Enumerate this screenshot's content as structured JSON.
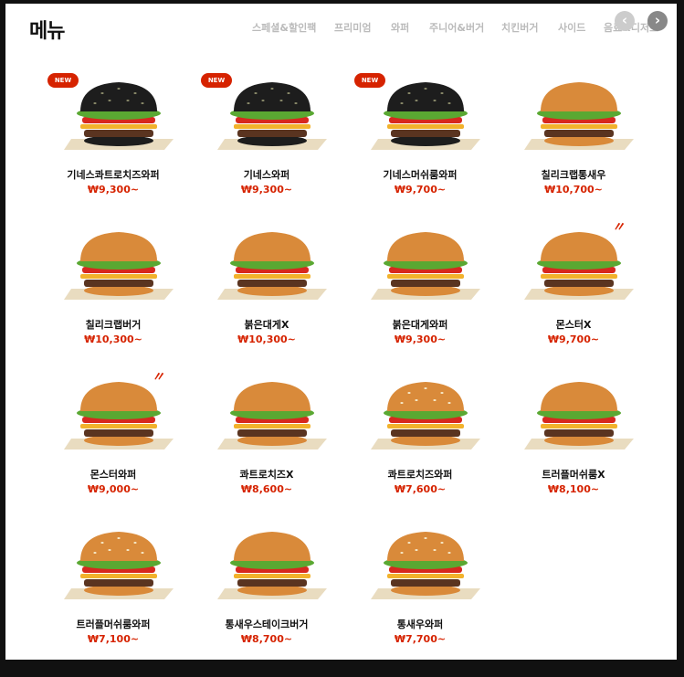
{
  "logo": "메뉴",
  "nav": {
    "items": [
      {
        "label": "스페셜&할인팩",
        "active": false
      },
      {
        "label": "프리미엄",
        "active": true
      },
      {
        "label": "와퍼",
        "active": false
      },
      {
        "label": "주니어&버거",
        "active": false
      },
      {
        "label": "치킨버거",
        "active": false
      },
      {
        "label": "사이드",
        "active": false
      },
      {
        "label": "음료&디저트",
        "active": false
      }
    ],
    "prev_icon": "chevron-left-icon",
    "next_icon": "chevron-right-icon",
    "prev_glyph": "‹",
    "next_glyph": "›"
  },
  "products": [
    {
      "name": "기네스콰트로치즈와퍼",
      "price": "₩9,300~",
      "badge": "NEW",
      "bun": "black"
    },
    {
      "name": "기네스와퍼",
      "price": "₩9,300~",
      "badge": "NEW",
      "bun": "black"
    },
    {
      "name": "기네스머쉬룸와퍼",
      "price": "₩9,700~",
      "badge": "NEW",
      "bun": "black"
    },
    {
      "name": "칠리크랩통새우",
      "price": "₩10,700~",
      "bun": "golden"
    },
    {
      "name": "칠리크랩버거",
      "price": "₩10,300~",
      "bun": "golden"
    },
    {
      "name": "붉은대게X",
      "price": "₩10,300~",
      "bun": "golden"
    },
    {
      "name": "붉은대게와퍼",
      "price": "₩9,300~",
      "bun": "golden"
    },
    {
      "name": "몬스터X",
      "price": "₩9,700~",
      "spicy": true,
      "bun": "golden"
    },
    {
      "name": "몬스터와퍼",
      "price": "₩9,000~",
      "spicy": true,
      "bun": "golden"
    },
    {
      "name": "콰트로치즈X",
      "price": "₩8,600~",
      "bun": "golden"
    },
    {
      "name": "콰트로치즈와퍼",
      "price": "₩7,600~",
      "bun": "sesame"
    },
    {
      "name": "트러플머쉬룸X",
      "price": "₩8,100~",
      "bun": "golden"
    },
    {
      "name": "트러플머쉬룸와퍼",
      "price": "₩7,100~",
      "bun": "sesame"
    },
    {
      "name": "통새우스테이크버거",
      "price": "₩8,700~",
      "bun": "golden"
    },
    {
      "name": "통새우와퍼",
      "price": "₩7,700~",
      "bun": "sesame"
    }
  ],
  "spicy_mark": "〃",
  "colors": {
    "accent": "#d62300",
    "bun_black": "#1d1d1d",
    "bun_golden": "#d98a3a",
    "lettuce": "#5aa832",
    "tomato": "#d7281e",
    "patty": "#5a3420",
    "cheese": "#f2b22c"
  }
}
